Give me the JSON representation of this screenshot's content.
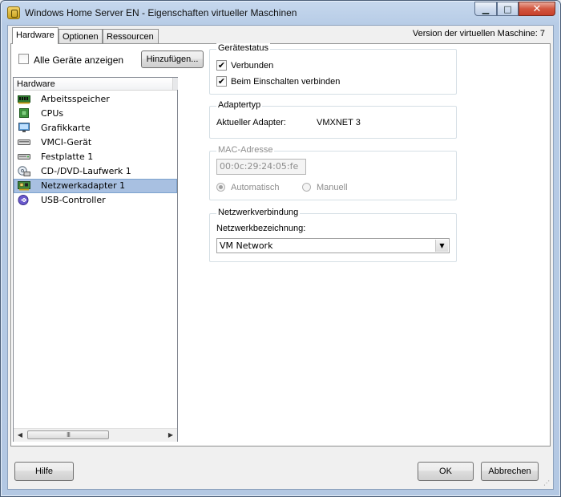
{
  "window": {
    "title": "Windows Home Server EN - Eigenschaften virtueller Maschinen",
    "minimize_glyph": "▁",
    "maximize_glyph": "□",
    "close_glyph": "✕"
  },
  "tabs": [
    {
      "label": "Hardware",
      "active": true
    },
    {
      "label": "Optionen",
      "active": false
    },
    {
      "label": "Ressourcen",
      "active": false
    }
  ],
  "version_label": "Version der virtuellen Maschine: 7",
  "show_all": {
    "label": "Alle Geräte anzeigen",
    "checked": false
  },
  "add_button": "Hinzufügen...",
  "hardware_list": {
    "header": "Hardware",
    "selected_index": 6,
    "items": [
      {
        "label": "Arbeitsspeicher",
        "icon": "memory-icon"
      },
      {
        "label": "CPUs",
        "icon": "cpu-icon"
      },
      {
        "label": "Grafikkarte",
        "icon": "monitor-icon"
      },
      {
        "label": "VMCI-Gerät",
        "icon": "vmci-device-icon"
      },
      {
        "label": "Festplatte 1",
        "icon": "hard-disk-icon"
      },
      {
        "label": "CD-/DVD-Laufwerk 1",
        "icon": "cd-dvd-drive-icon"
      },
      {
        "label": "Netzwerkadapter 1",
        "icon": "network-adapter-icon"
      },
      {
        "label": "USB-Controller",
        "icon": "usb-icon"
      }
    ],
    "scroll_grip": "III",
    "scroll_left": "◀",
    "scroll_right": "▶"
  },
  "device_status": {
    "legend": "Gerätestatus",
    "connected": {
      "label": "Verbunden",
      "checked": true
    },
    "connect_on_power": {
      "label": "Beim Einschalten verbinden",
      "checked": true
    }
  },
  "adapter_type": {
    "legend": "Adaptertyp",
    "current_label": "Aktueller Adapter:",
    "current_value": "VMXNET 3"
  },
  "mac_address": {
    "legend": "MAC-Adresse",
    "value": "00:0c:29:24:05:fe",
    "auto_label": "Automatisch",
    "manual_label": "Manuell",
    "selected": "auto"
  },
  "network_connection": {
    "legend": "Netzwerkverbindung",
    "name_label": "Netzwerkbezeichnung:",
    "selected": "VM Network",
    "drop_glyph": "▼"
  },
  "footer": {
    "help": "Hilfe",
    "ok": "OK",
    "cancel": "Abbrechen"
  },
  "colors": {
    "selection": "#a8c0e1",
    "titlebar": "#b7cce6",
    "close_button": "#c7402b"
  }
}
